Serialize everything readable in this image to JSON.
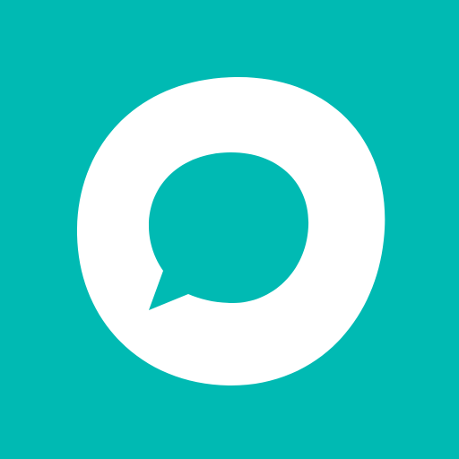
{
  "icon": {
    "name": "chat-bubble-app-icon",
    "background_color": "#00BAB3",
    "ring_color": "#FFFFFF",
    "bubble_color": "#00BAB3"
  }
}
